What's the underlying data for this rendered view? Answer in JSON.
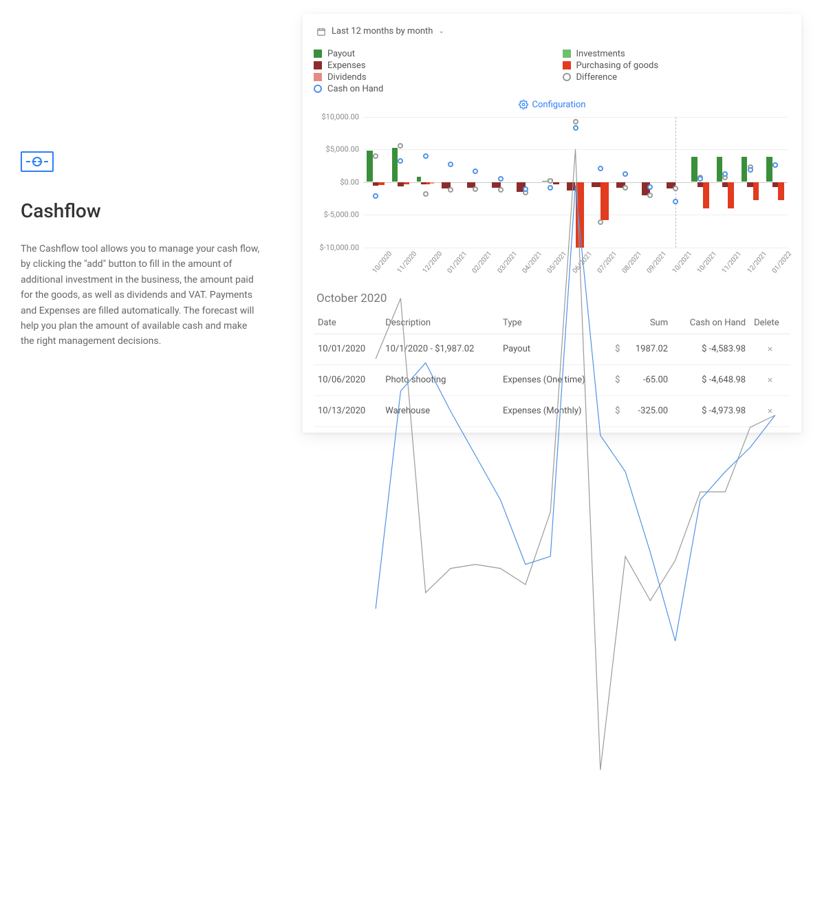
{
  "left": {
    "title": "Cashflow",
    "description": "The Cashflow tool allows you to manage your cash flow, by clicking the \"add\" button to fill in the amount of additional investment in the business, the amount paid for the goods, as well as dividends and VAT. Payments and Expenses are filled automatically. The forecast will help you plan the amount of available cash and make the right management decisions."
  },
  "panel": {
    "period_label": "Last 12 months by month",
    "config_label": "Configuration",
    "legend": [
      {
        "label": "Payout",
        "color": "#3a8f3a",
        "shape": "square"
      },
      {
        "label": "Investments",
        "color": "#6fbf6f",
        "shape": "square"
      },
      {
        "label": "Expenses",
        "color": "#8c2c2c",
        "shape": "square"
      },
      {
        "label": "Purchasing of goods",
        "color": "#e23b1f",
        "shape": "square"
      },
      {
        "label": "Dividends",
        "color": "#e58b86",
        "shape": "square"
      },
      {
        "label": "Difference",
        "color": "#9a9a9a",
        "shape": "circle"
      },
      {
        "label": "Cash on Hand",
        "color": "#4f93e6",
        "shape": "circle"
      }
    ]
  },
  "chart_data": {
    "type": "bar",
    "xlabel": "",
    "ylabel": "",
    "ylim": [
      -10000,
      10000
    ],
    "yticks": [
      "$10,000.00",
      "$5,000.00",
      "$0.00",
      "$-5,000.00",
      "$-10,000.00"
    ],
    "categories": [
      "10/2020",
      "11/2020",
      "12/2020",
      "01/2021",
      "02/2021",
      "03/2021",
      "04/2021",
      "05/2021",
      "06/2021",
      "07/2021",
      "08/2021",
      "09/2021",
      "10/2021",
      "10/2021",
      "11/2021",
      "12/2021",
      "01/2022"
    ],
    "forecast_start_index": 13,
    "series": [
      {
        "name": "Payout",
        "type": "bar",
        "color": "#3a8f3a",
        "values": [
          4800,
          5200,
          800,
          0,
          0,
          0,
          0,
          200,
          0,
          0,
          0,
          0,
          0,
          3800,
          3800,
          3800,
          3800
        ]
      },
      {
        "name": "Investments",
        "type": "bar",
        "color": "#6fbf6f",
        "values": [
          0,
          0,
          0,
          0,
          0,
          0,
          0,
          500,
          0,
          0,
          0,
          0,
          0,
          0,
          0,
          0,
          0
        ]
      },
      {
        "name": "Expenses",
        "type": "bar",
        "color": "#8c2c2c",
        "values": [
          -600,
          -700,
          -400,
          -1000,
          -900,
          -900,
          -1500,
          -400,
          -1300,
          -800,
          -900,
          -2000,
          -1000,
          -800,
          -800,
          -800,
          -800
        ]
      },
      {
        "name": "Purchasing of goods",
        "type": "bar",
        "color": "#e23b1f",
        "values": [
          -500,
          -400,
          -400,
          0,
          0,
          0,
          0,
          0,
          -10000,
          -5800,
          0,
          0,
          0,
          -4000,
          -4000,
          -2800,
          -2800
        ]
      },
      {
        "name": "Dividends",
        "type": "bar",
        "color": "#e58b86",
        "values": [
          0,
          0,
          -300,
          0,
          0,
          0,
          0,
          0,
          0,
          0,
          0,
          0,
          0,
          0,
          0,
          0,
          0
        ]
      },
      {
        "name": "Difference",
        "type": "line",
        "color": "#9a9a9a",
        "values": [
          4000,
          5500,
          -1800,
          -1200,
          -1100,
          -1200,
          -1600,
          200,
          9200,
          -6200,
          -900,
          -2000,
          -1000,
          700,
          700,
          2300,
          2600
        ]
      },
      {
        "name": "Cash on Hand",
        "type": "line",
        "color": "#4f93e6",
        "values": [
          -2200,
          3200,
          3900,
          2700,
          1600,
          500,
          -1100,
          -900,
          8300,
          2100,
          1200,
          -800,
          -3000,
          500,
          1200,
          1800,
          2600
        ]
      }
    ]
  },
  "table": {
    "month_title": "October 2020",
    "headers": {
      "date": "Date",
      "desc": "Description",
      "type": "Type",
      "sum": "Sum",
      "cash": "Cash on Hand",
      "del": "Delete"
    },
    "rows": [
      {
        "date": "10/01/2020",
        "desc": "10/1/2020 - $1,987.02",
        "type": "Payout",
        "sum": "1987.02",
        "cash": "$ -4,583.98"
      },
      {
        "date": "10/06/2020",
        "desc": "Photo shooting",
        "type": "Expenses (One time)",
        "sum": "-65.00",
        "cash": "$ -4,648.98"
      },
      {
        "date": "10/13/2020",
        "desc": "Warehouse",
        "type": "Expenses (Monthly)",
        "sum": "-325.00",
        "cash": "$ -4,973.98"
      }
    ]
  }
}
